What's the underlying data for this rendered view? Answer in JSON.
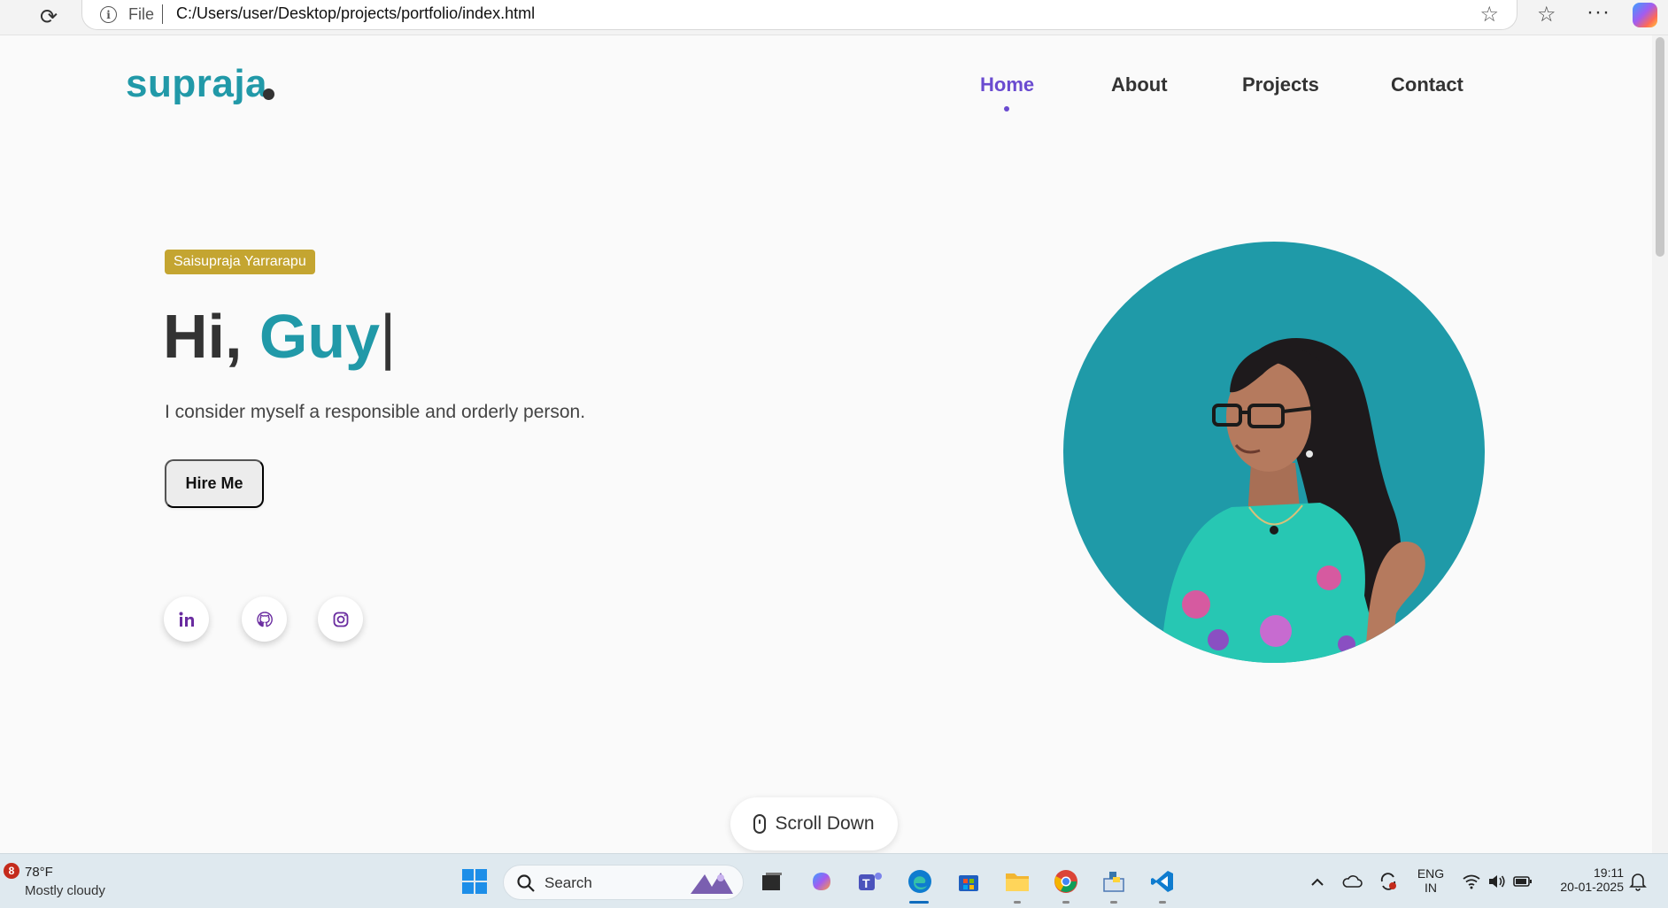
{
  "browser": {
    "address_prefix": "File",
    "url": "C:/Users/user/Desktop/projects/portfolio/index.html"
  },
  "page": {
    "logo": "supraja",
    "nav": [
      "Home",
      "About",
      "Projects",
      "Contact"
    ],
    "active_nav": "Home",
    "badge": "Saisupraja Yarrarapu",
    "greeting_prefix": "Hi,",
    "greeting_name": "Guy",
    "greeting_cursor": "|",
    "tagline": "I consider myself a responsible and orderly person.",
    "hire_button": "Hire Me",
    "socials": [
      "linkedin-icon",
      "github-icon",
      "instagram-icon"
    ],
    "scroll_label": "Scroll Down",
    "colors": {
      "accent": "#2199a8",
      "nav_active": "#6a4bd0",
      "badge": "#c4a531"
    }
  },
  "taskbar": {
    "weather_badge": "8",
    "weather_temp": "78°F",
    "weather_condition": "Mostly cloudy",
    "search_label": "Search",
    "language_top": "ENG",
    "language_bottom": "IN",
    "time": "19:11",
    "date": "20-01-2025"
  }
}
